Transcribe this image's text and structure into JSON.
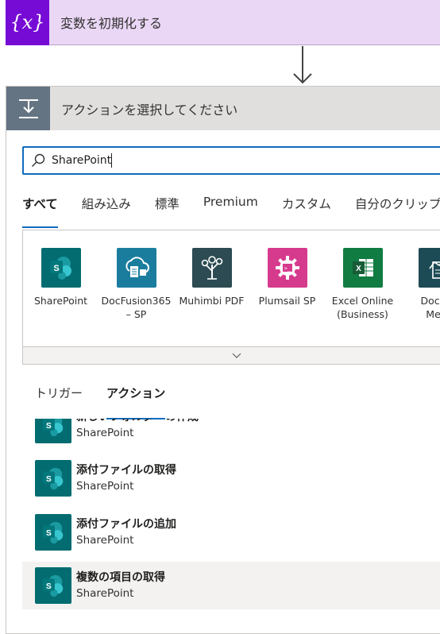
{
  "variable_step": {
    "icon_text": "{x}",
    "title": "変数を初期化する"
  },
  "picker": {
    "title": "アクションを選択してください",
    "search": {
      "value": "SharePoint"
    },
    "tabs": [
      {
        "label": "すべて",
        "active": true
      },
      {
        "label": "組み込み",
        "active": false
      },
      {
        "label": "標準",
        "active": false
      },
      {
        "label": "Premium",
        "active": false
      },
      {
        "label": "カスタム",
        "active": false
      },
      {
        "label": "自分のクリップ",
        "active": false
      }
    ],
    "connectors": [
      {
        "label": "SharePoint",
        "color": "#036c70",
        "icon": "sharepoint-icon"
      },
      {
        "label": "DocFusion365 – SP",
        "color": "#1a7d9e",
        "icon": "docfusion-icon"
      },
      {
        "label": "Muhimbi PDF",
        "color": "#2c4b52",
        "icon": "muhimbi-tree-icon"
      },
      {
        "label": "Plumsail SP",
        "color": "#d63a8c",
        "icon": "plumsail-gear-icon"
      },
      {
        "label": "Excel Online (Business)",
        "color": "#107c41",
        "icon": "excel-icon"
      },
      {
        "label": "Docu...\nMe...",
        "color": "#1d4b55",
        "icon": "document-icon"
      }
    ],
    "subtabs": [
      {
        "label": "トリガー",
        "active": false
      },
      {
        "label": "アクション",
        "active": true
      }
    ],
    "actions": [
      {
        "name": "新しいフォルダーの作成",
        "connector": "SharePoint"
      },
      {
        "name": "添付ファイルの取得",
        "connector": "SharePoint"
      },
      {
        "name": "添付ファイルの追加",
        "connector": "SharePoint"
      },
      {
        "name": "複数の項目の取得",
        "connector": "SharePoint"
      }
    ]
  },
  "colors": {
    "accent": "#0f6cbd",
    "variable_purple": "#770bd6",
    "sharepoint": "#036c70"
  }
}
